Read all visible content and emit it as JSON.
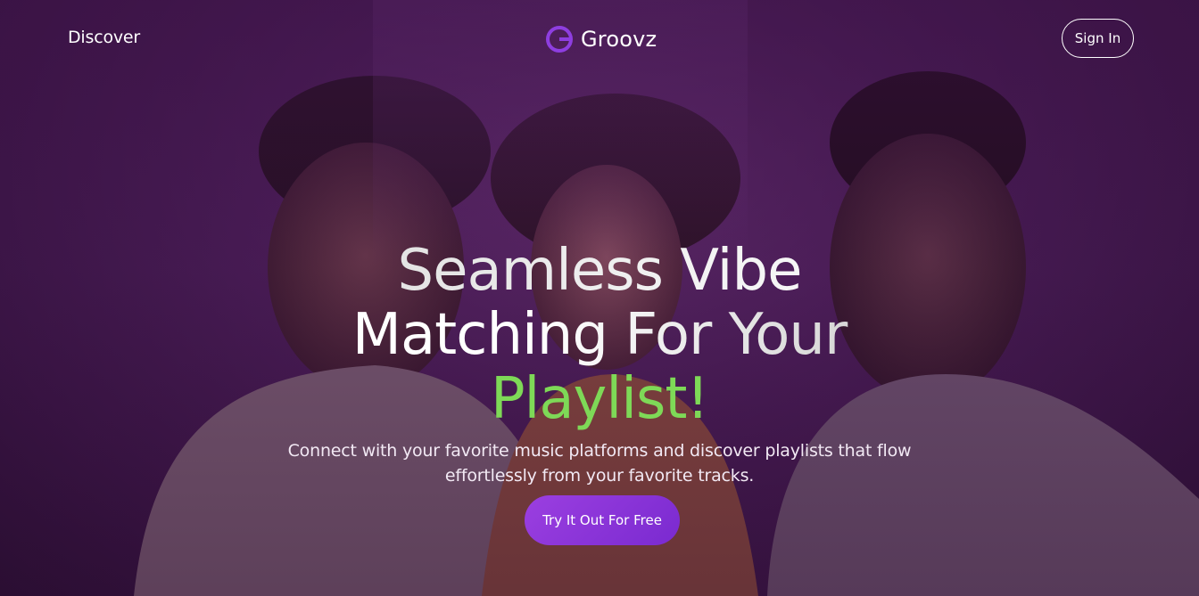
{
  "nav": {
    "discover_label": "Discover",
    "signin_label": "Sign In"
  },
  "brand": {
    "name": "Groovz",
    "icon": "groovz-logo-icon",
    "accent_color": "#8e3ee0"
  },
  "hero": {
    "headline_line1": "Seamless Vibe",
    "headline_line2": "Matching For Your",
    "headline_line3": "Playlist!",
    "highlight_color": "#7ed957",
    "subtext": "Connect with your favorite music platforms and discover playlists that flow effortlessly from your favorite tracks.",
    "cta_label": "Try It Out For Free",
    "background_image": "three people listening to music with earphones"
  }
}
